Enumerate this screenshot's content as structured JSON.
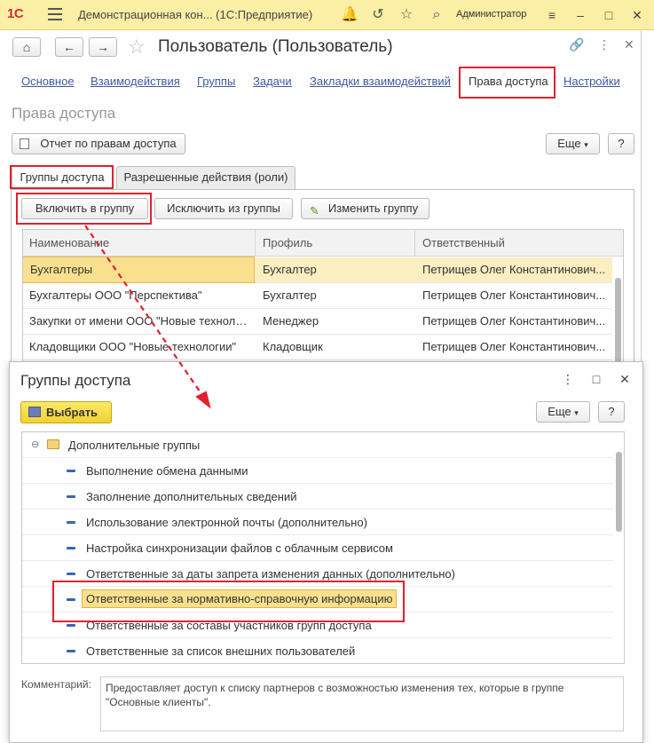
{
  "titlebar": {
    "logo": "1С",
    "app_title": "Демонстрационная кон...  (1С:Предприятие)",
    "user": "Администратор"
  },
  "form": {
    "title": "Пользователь (Пользователь)",
    "links": [
      "Основное",
      "Взаимодействия",
      "Группы",
      "Задачи",
      "Закладки взаимодействий",
      "Права доступа",
      "Настройки"
    ],
    "section_title": "Права доступа",
    "report_button": "Отчет по правам доступа",
    "more_button": "Еще",
    "help_button": "?",
    "tabs": [
      "Группы доступа",
      "Разрешенные действия (роли)"
    ],
    "include_button": "Включить в группу",
    "exclude_button": "Исключить из группы",
    "change_button": "Изменить группу",
    "table": {
      "columns": [
        "Наименование",
        "Профиль",
        "Ответственный"
      ],
      "rows": [
        {
          "name": "Бухгалтеры",
          "profile": "Бухгалтер",
          "responsible": "Петрищев Олег Константинович..."
        },
        {
          "name": "Бухгалтеры ООО \"Перспектива\"",
          "profile": "Бухгалтер",
          "responsible": "Петрищев Олег Константинович..."
        },
        {
          "name": "Закупки от имени ООО \"Новые техноло...",
          "profile": "Менеджер",
          "responsible": "Петрищев Олег Константинович..."
        },
        {
          "name": "Кладовщики ООО \"Новые технологии\"",
          "profile": "Кладовщик",
          "responsible": "Петрищев Олег Константинович..."
        }
      ]
    }
  },
  "dialog": {
    "title": "Группы доступа",
    "select_button": "Выбрать",
    "more_button": "Еще",
    "help_button": "?",
    "tree_root": "Дополнительные группы",
    "items": [
      "Выполнение обмена данными",
      "Заполнение дополнительных сведений",
      "Использование электронной почты (дополнительно)",
      "Настройка синхронизации файлов с облачным сервисом",
      "Ответственные за даты запрета изменения данных (дополнительно)",
      "Ответственные за нормативно-справочную информацию",
      "Ответственные за составы участников групп доступа",
      "Ответственные за список внешних пользователей"
    ],
    "comment_label": "Комментарий:",
    "comment_text": "Предоставляет доступ к списку партнеров с возможностью изменения тех, которые в группе \"Основные клиенты\"."
  },
  "colors": {
    "highlight_red": "#e0202f",
    "selection_yellow": "#f9e08e",
    "link_blue": "#3e5a9e",
    "titlebar_yellow": "#fbeea5"
  }
}
